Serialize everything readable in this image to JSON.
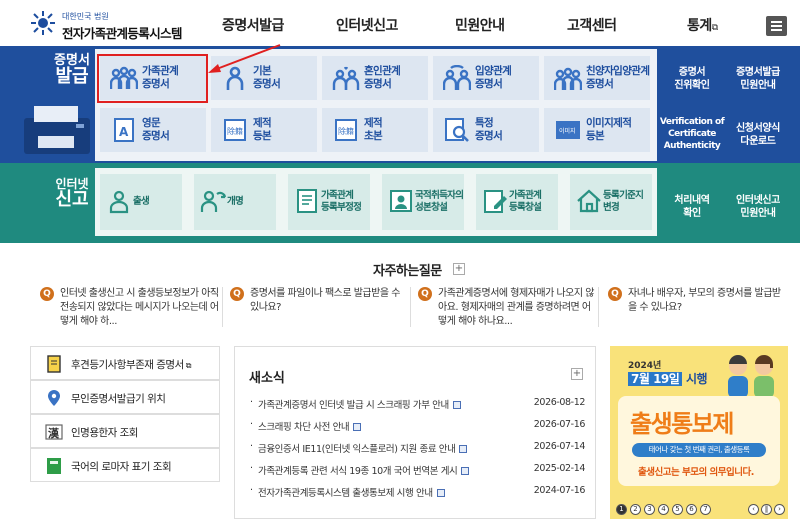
{
  "header": {
    "logo_sub": "대한민국 법원",
    "logo_main": "전자가족관계등록시스템",
    "nav": [
      "증명서발급",
      "인터넷신고",
      "민원안내",
      "고객센터",
      "통계"
    ]
  },
  "certificate": {
    "title_line1": "증명서",
    "title_line2": "발급",
    "tiles": [
      {
        "label": "가족관계\n증명서",
        "icon": "family-icon"
      },
      {
        "label": "기본\n증명서",
        "icon": "person-icon"
      },
      {
        "label": "혼인관계\n증명서",
        "icon": "couple-heart-icon"
      },
      {
        "label": "입양관계\n증명서",
        "icon": "adoption-icon"
      },
      {
        "label": "친양자입양관계\n증명서",
        "icon": "family-adoption-icon"
      },
      {
        "label": "영문\n증명서",
        "icon": "english-doc-icon"
      },
      {
        "label": "제적\n등본",
        "icon": "removed-record-icon"
      },
      {
        "label": "제적\n초본",
        "icon": "removed-abstract-icon"
      },
      {
        "label": "특정\n증명서",
        "icon": "magnifier-doc-icon"
      },
      {
        "label": "이미지제적\n등본",
        "icon": "image-record-icon"
      }
    ],
    "side_links": [
      {
        "label": "증명서\n진위확인"
      },
      {
        "label": "증명서발급\n민원안내"
      },
      {
        "label": "Verification of\nCertificate\nAuthenticity"
      },
      {
        "label": "신청서양식\n다운로드"
      }
    ]
  },
  "report": {
    "title_line1": "인터넷",
    "title_line2": "신고",
    "tiles": [
      {
        "label": "출생",
        "icon": "baby-icon"
      },
      {
        "label": "개명",
        "icon": "rename-icon"
      },
      {
        "label": "가족관계\n등록부정정",
        "icon": "correction-doc-icon"
      },
      {
        "label": "국적취득자의\n성본창설",
        "icon": "nationality-icon"
      },
      {
        "label": "가족관계\n등록창설",
        "icon": "registration-create-icon"
      },
      {
        "label": "등록기준지\n변경",
        "icon": "house-icon"
      }
    ],
    "side_links": [
      {
        "label": "처리내역\n확인"
      },
      {
        "label": "인터넷신고\n민원안내"
      }
    ]
  },
  "faq": {
    "title": "자주하는질문",
    "items": [
      "인터넷 출생신고 시 출생등보정보가 아직 전송되지 않았다는 메시지가 나오는데 어떻게 해야 하...",
      "증명서를 파일이나 팩스로 발급받을 수 있나요?",
      "가족관계증명서에 형제자매가 나오지 않아요. 형제자매의 관계를 증명하려면 어떻게 해야 하나요...",
      "자녀나 배우자, 부모의 증명서를 발급받을 수 있나요?"
    ]
  },
  "quick_links": [
    {
      "label": "후견등기사항부존재 증명서",
      "icon": "document-icon"
    },
    {
      "label": "무인증명서발급기 위치",
      "icon": "location-pin-icon"
    },
    {
      "label": "인명용한자 조회",
      "icon": "hanja-book-icon"
    },
    {
      "label": "국어의 로마자 표기 조회",
      "icon": "green-book-icon"
    }
  ],
  "news": {
    "title": "새소식",
    "items": [
      {
        "title": "가족관계증명서 인터넷 발급 시 스크래핑 가부 안내",
        "date": "2026-08-12"
      },
      {
        "title": "스크래핑 차단 사전 안내",
        "date": "2026-07-16"
      },
      {
        "title": "금융인증서 IE11(인터넷 익스플로러) 지원 종료 안내",
        "date": "2026-07-14"
      },
      {
        "title": "가족관계등록 관련 서식 19종 10개 국어 번역본 게시",
        "date": "2025-02-14"
      },
      {
        "title": "전자가족관계등록시스템 출생통보제 시행 안내",
        "date": "2024-07-16"
      }
    ]
  },
  "banner": {
    "date_top": "2024년",
    "date_main_box": "7월 19일",
    "date_main_rest": "시행",
    "headline": "출생통보제",
    "subline": "태어나 갖는 첫 번째 권리, 출생등록",
    "footer": "출생신고는 부모의 의무입니다.",
    "pages": [
      "1",
      "2",
      "3",
      "4",
      "5",
      "6",
      "7"
    ]
  },
  "colors": {
    "cert_band": "#1f4f9d",
    "report_band": "#1f8a7f",
    "highlight": "#e02020",
    "faq_badge": "#d0701c"
  }
}
